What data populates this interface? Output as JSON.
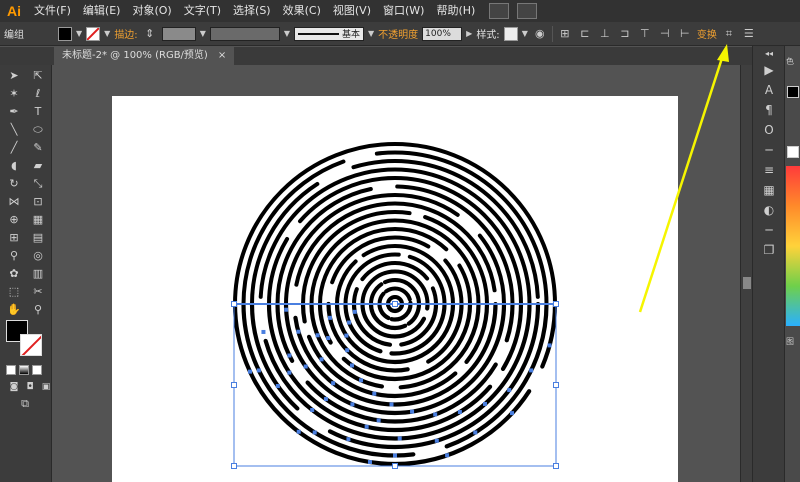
{
  "app": {
    "logo": "Ai"
  },
  "menu": {
    "items": [
      {
        "id": "file",
        "label": "文件(F)"
      },
      {
        "id": "edit",
        "label": "编辑(E)"
      },
      {
        "id": "object",
        "label": "对象(O)"
      },
      {
        "id": "type",
        "label": "文字(T)"
      },
      {
        "id": "select",
        "label": "选择(S)"
      },
      {
        "id": "effect",
        "label": "效果(C)"
      },
      {
        "id": "view",
        "label": "视图(V)"
      },
      {
        "id": "window",
        "label": "窗口(W)"
      },
      {
        "id": "help",
        "label": "帮助(H)"
      }
    ]
  },
  "control": {
    "selection_label": "编组",
    "stroke_label": "描边:",
    "stroke_style": "基本",
    "opacity_label": "不透明度",
    "opacity_value": "100%",
    "style_label": "样式:",
    "transform_label": "变换"
  },
  "document": {
    "tab_title": "未标题-2* @ 100% (RGB/预览)",
    "close_label": "×"
  },
  "panels": {
    "color_label": "色",
    "appearance_label": "图"
  },
  "colors": {
    "accent": "#f0a030",
    "selection": "#4a7fe0",
    "annotation_arrow": "#f5f500"
  }
}
